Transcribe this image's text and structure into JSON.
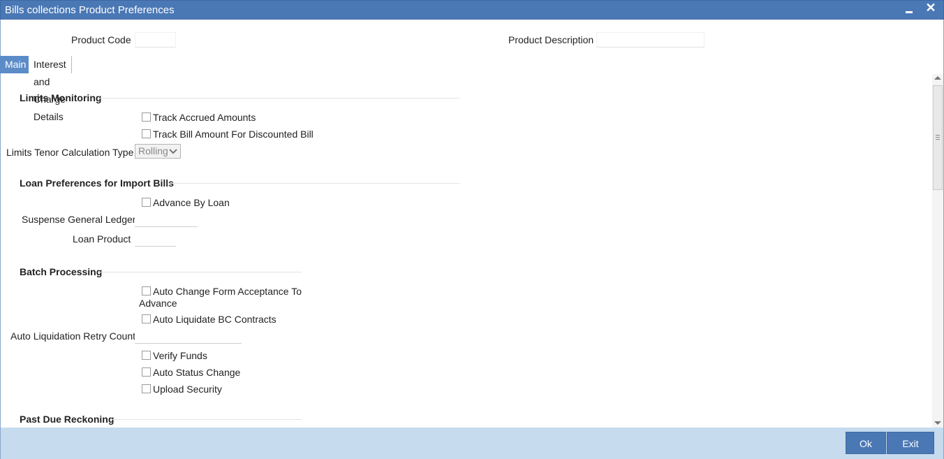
{
  "window": {
    "title": "Bills collections Product Preferences"
  },
  "header": {
    "product_code_label": "Product Code",
    "product_code_value": "",
    "product_description_label": "Product Description",
    "product_description_value": ""
  },
  "tabs": [
    {
      "label": "Main",
      "active": true
    },
    {
      "label": "Interest and Charge Details",
      "active": false
    }
  ],
  "limits_monitoring": {
    "title": "Limits Monitoring",
    "track_accrued_amounts": "Track Accrued Amounts",
    "track_bill_amount": "Track Bill Amount For Discounted Bill",
    "tenor_calc_label": "Limits Tenor Calculation Type",
    "tenor_calc_value": "Rolling"
  },
  "loan_preferences": {
    "title": "Loan Preferences for Import Bills",
    "advance_by_loan": "Advance By Loan",
    "suspense_gl_label": "Suspense General Ledger",
    "suspense_gl_value": "",
    "loan_product_label": "Loan Product",
    "loan_product_value": ""
  },
  "batch_processing": {
    "title": "Batch Processing",
    "auto_change_line1": "Auto Change Form Acceptance To",
    "auto_change_line2": "Advance",
    "auto_liquidate": "Auto Liquidate BC Contracts",
    "retry_count_label": "Auto Liquidation Retry Count",
    "retry_count_value": "",
    "verify_funds": "Verify Funds",
    "auto_status_change": "Auto Status Change",
    "upload_security": "Upload Security"
  },
  "past_due": {
    "title": "Past Due Reckoning"
  },
  "footer": {
    "ok_label": "Ok",
    "exit_label": "Exit"
  },
  "colors": {
    "titlebar": "#4a78b5",
    "tab_active": "#5b8cc8",
    "footer": "#c7dbef",
    "button": "#4a78b5"
  }
}
